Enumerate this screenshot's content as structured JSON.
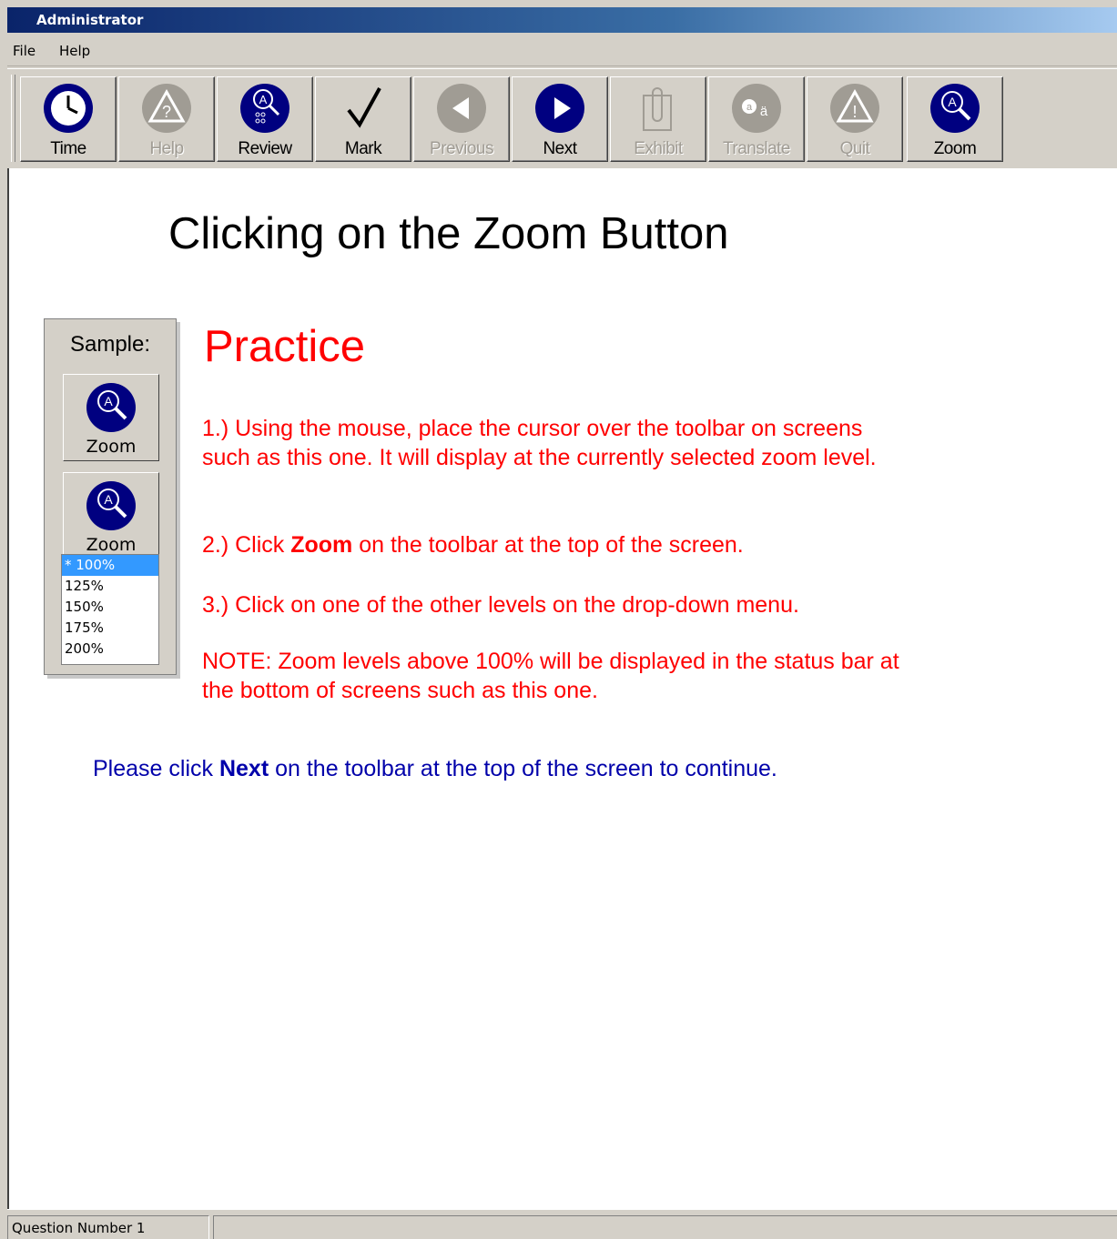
{
  "window": {
    "title": "Administrator"
  },
  "menu": {
    "file": "File",
    "help": "Help"
  },
  "toolbar": {
    "buttons": [
      {
        "label": "Time",
        "icon": "clock-icon",
        "enabled": true
      },
      {
        "label": "Help",
        "icon": "help-icon",
        "enabled": false
      },
      {
        "label": "Review",
        "icon": "review-icon",
        "enabled": true
      },
      {
        "label": "Mark",
        "icon": "checkmark-icon",
        "enabled": true
      },
      {
        "label": "Previous",
        "icon": "previous-arrow-icon",
        "enabled": false
      },
      {
        "label": "Next",
        "icon": "next-arrow-icon",
        "enabled": true
      },
      {
        "label": "Exhibit",
        "icon": "exhibit-icon",
        "enabled": false
      },
      {
        "label": "Translate",
        "icon": "translate-icon",
        "enabled": false
      },
      {
        "label": "Quit",
        "icon": "quit-icon",
        "enabled": false
      },
      {
        "label": "Zoom",
        "icon": "zoom-icon",
        "enabled": true
      }
    ]
  },
  "content": {
    "heading": "Clicking on the Zoom Button",
    "sample": {
      "title": "Sample:",
      "button_label": "Zoom",
      "button_label_2": "Zoom",
      "zoom_options": [
        "* 100%",
        "125%",
        "150%",
        "175%",
        "200%"
      ],
      "selected_option": "* 100%"
    },
    "practice_title": "Practice",
    "step1": "1.) Using the mouse, place the cursor over the toolbar on screens such as this one. It will display at the currently selected zoom level.",
    "step2_prefix": "2.) Click ",
    "step2_bold": "Zoom",
    "step2_suffix": " on the toolbar at the top of the screen.",
    "step3": "3.) Click on one of the other levels on the drop-down menu.",
    "note": "NOTE: Zoom levels above 100% will be displayed in the status bar at the bottom of screens such as this one.",
    "continue_prefix": "Please click ",
    "continue_bold": "Next",
    "continue_suffix": " on the toolbar at the top of the screen to continue."
  },
  "status": {
    "question": "Question Number 1"
  },
  "colors": {
    "accent": "#ff0000",
    "link_blue": "#0000aa",
    "icon_navy": "#000080",
    "icon_disabled": "#a09c94"
  }
}
